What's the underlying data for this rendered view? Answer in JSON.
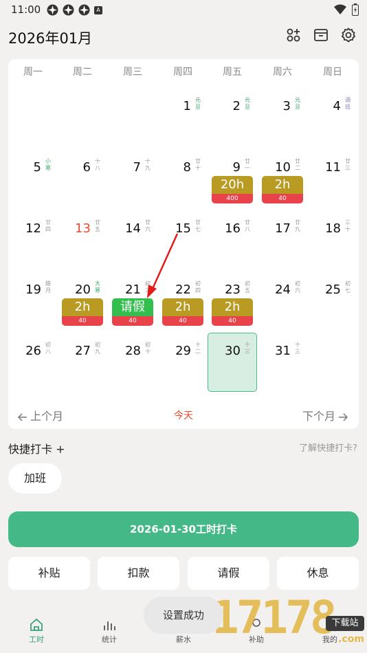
{
  "status_bar": {
    "time": "11:00",
    "badge": "A"
  },
  "header": {
    "title": "2026年01月"
  },
  "weekdays": [
    "周一",
    "周二",
    "周三",
    "周四",
    "周五",
    "周六",
    "周日"
  ],
  "days": [
    {
      "num": "1",
      "sub": "元旦"
    },
    {
      "num": "2",
      "sub": "元旦"
    },
    {
      "num": "3",
      "sub": "元旦"
    },
    {
      "num": "4",
      "sub": "调班"
    },
    {
      "num": "5",
      "sub": "小寒"
    },
    {
      "num": "6",
      "sub": "十八"
    },
    {
      "num": "7",
      "sub": "十九"
    },
    {
      "num": "8",
      "sub": "廿十"
    },
    {
      "num": "9",
      "sub": "廿一"
    },
    {
      "num": "10",
      "sub": "廿二"
    },
    {
      "num": "11",
      "sub": "廿三"
    },
    {
      "num": "12",
      "sub": "廿四"
    },
    {
      "num": "13",
      "sub": "廿五"
    },
    {
      "num": "14",
      "sub": "廿六"
    },
    {
      "num": "15",
      "sub": "廿七"
    },
    {
      "num": "16",
      "sub": "廿八"
    },
    {
      "num": "17",
      "sub": "廿九"
    },
    {
      "num": "18",
      "sub": "三十"
    },
    {
      "num": "19",
      "sub": "腊月"
    },
    {
      "num": "20",
      "sub": "大寒"
    },
    {
      "num": "21",
      "sub": "初三"
    },
    {
      "num": "22",
      "sub": "初四"
    },
    {
      "num": "23",
      "sub": "初五"
    },
    {
      "num": "24",
      "sub": "初六"
    },
    {
      "num": "25",
      "sub": "初七"
    },
    {
      "num": "26",
      "sub": "初八"
    },
    {
      "num": "27",
      "sub": "初九"
    },
    {
      "num": "28",
      "sub": "初十"
    },
    {
      "num": "29",
      "sub": "十二"
    },
    {
      "num": "30",
      "sub": "十三"
    },
    {
      "num": "31",
      "sub": "十三"
    }
  ],
  "tags": [
    {
      "day": "9",
      "top": "20h",
      "bottom": "400"
    },
    {
      "day": "10",
      "top": "2h",
      "bottom": "40"
    },
    {
      "day": "20",
      "top": "2h",
      "bottom": "40"
    },
    {
      "day": "21",
      "top": "请假",
      "bottom": "40"
    },
    {
      "day": "22",
      "top": "2h",
      "bottom": "40"
    },
    {
      "day": "23",
      "top": "2h",
      "bottom": "40"
    }
  ],
  "calendar_footer": {
    "prev": "上个月",
    "today": "今天",
    "next": "下个月"
  },
  "quick": {
    "title": "快捷打卡 +",
    "help": "了解快捷打卡?",
    "chip": "加班"
  },
  "main_button": "2026-01-30工时打卡",
  "actions": [
    "补贴",
    "扣款",
    "请假",
    "休息"
  ],
  "nav": [
    "工时",
    "统计",
    "薪水",
    "补助",
    "我的"
  ],
  "toast": "设置成功",
  "watermark": {
    "num": "17178",
    "text": "下载站",
    "com": ".com"
  },
  "colors": {
    "accent": "#45b888",
    "tag_gold": "#b99a23",
    "tag_green": "#32bf4e",
    "tag_red": "#e8434b",
    "today_red": "#e84a2f"
  }
}
